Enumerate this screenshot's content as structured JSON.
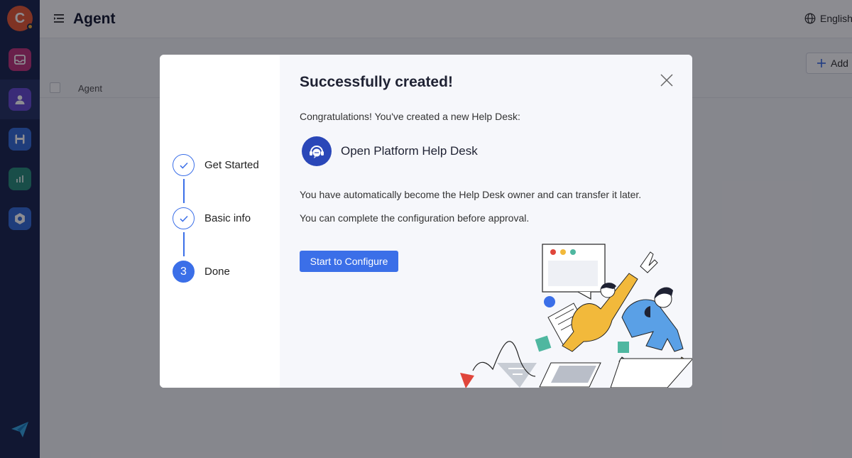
{
  "sidebar": {
    "logo_letter": "C",
    "items": [
      {
        "icon": "inbox-icon",
        "color": "#c0397e"
      },
      {
        "icon": "user-icon",
        "color": "#6b4fd1"
      },
      {
        "icon": "save-icon",
        "color": "#3a6fd8"
      },
      {
        "icon": "chart-icon",
        "color": "#2e8f7c"
      },
      {
        "icon": "settings-icon",
        "color": "#3a6fd8"
      }
    ]
  },
  "header": {
    "title": "Agent",
    "language": "English"
  },
  "content": {
    "add_label": "Add",
    "column_agent": "Agent"
  },
  "modal": {
    "steps": [
      {
        "label": "Get Started",
        "state": "done"
      },
      {
        "label": "Basic info",
        "state": "done"
      },
      {
        "label": "Done",
        "state": "current",
        "number": "3"
      }
    ],
    "title": "Successfully created!",
    "congrats": "Congratulations! You've created a new Help Desk:",
    "help_desk_name": "Open Platform Help Desk",
    "info_owner": "You have automatically become the Help Desk owner and can transfer it later.",
    "info_config": "You can complete the configuration before approval.",
    "configure_button": "Start to Configure"
  },
  "colors": {
    "primary": "#3b6fe8",
    "sidebar": "#1f2a52"
  }
}
